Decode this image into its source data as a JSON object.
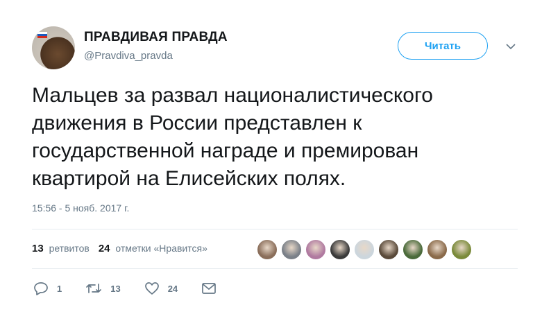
{
  "user": {
    "display_name": "ПРАВДИВАЯ ПРАВДА",
    "handle": "@Pravdiva_pravda"
  },
  "follow_button_label": "Читать",
  "tweet": {
    "text": "Мальцев за развал националистического\nдвижения в России представлен к\nгосударственной награде и премирован\nквартирой на Елисейских полях.",
    "timestamp": "15:56 - 5 нояб. 2017 г."
  },
  "stats": {
    "retweets_count": "13",
    "retweets_label": "ретвитов",
    "likes_count": "24",
    "likes_label": "отметки «Нравится»"
  },
  "likers": [
    {
      "color": "#8a6e5a"
    },
    {
      "color": "#7a8088"
    },
    {
      "color": "#b07aa0"
    },
    {
      "color": "#3a3a3a"
    },
    {
      "color": "#ccd6dd"
    },
    {
      "color": "#5a4a3a"
    },
    {
      "color": "#4a6a3a"
    },
    {
      "color": "#8a6a4a"
    },
    {
      "color": "#7a8a3a"
    }
  ],
  "actions": {
    "reply_count": "1",
    "retweet_count": "13",
    "like_count": "24"
  },
  "icons": {
    "reply": "reply-icon",
    "retweet": "retweet-icon",
    "like": "heart-icon",
    "dm": "envelope-icon",
    "caret": "chevron-down-icon"
  },
  "colors": {
    "accent": "#1da1f2",
    "secondary_text": "#657786",
    "divider": "#e6ecf0"
  }
}
